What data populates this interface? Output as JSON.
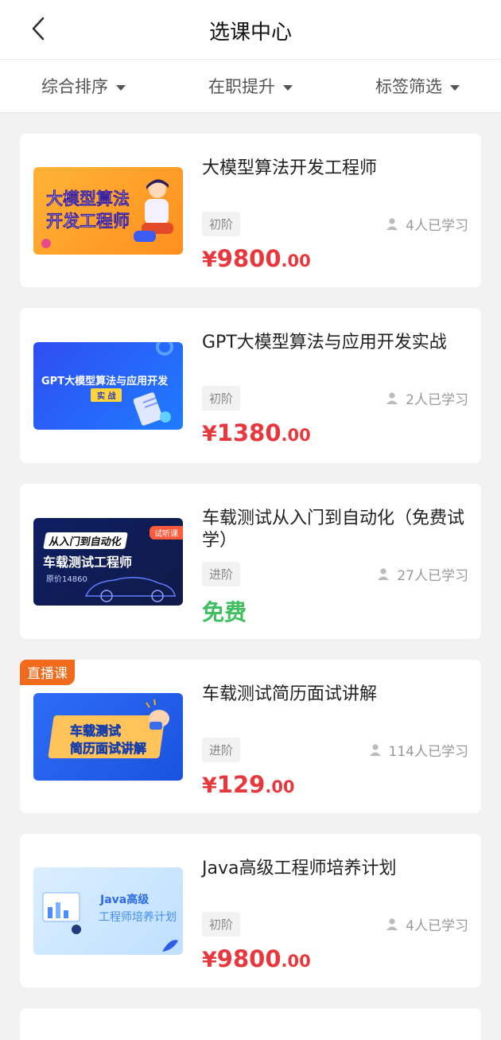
{
  "header": {
    "title": "选课中心",
    "back_icon": "chevron-left-icon"
  },
  "filters": [
    {
      "label": "综合排序"
    },
    {
      "label": "在职提升"
    },
    {
      "label": "标签筛选"
    }
  ],
  "courses": [
    {
      "title": "大模型算法开发工程师",
      "level": "初阶",
      "learners": "4人已学习",
      "price": {
        "yen": "¥",
        "int": "9800",
        "dec": ".00"
      },
      "thumb": {
        "line1": "大模型算法",
        "line2": "开发工程师"
      }
    },
    {
      "title": "GPT大模型算法与应用开发实战",
      "level": "初阶",
      "learners": "2人已学习",
      "price": {
        "yen": "¥",
        "int": "1380",
        "dec": ".00"
      },
      "thumb": {
        "line1": "GPT大模型算法与应用开发",
        "tag": "实 战"
      }
    },
    {
      "title": "车载测试从入门到自动化（免费试学）",
      "level": "进阶",
      "learners": "27人已学习",
      "price_text": "免费",
      "thumb": {
        "line1": "从入门到自动化",
        "line2": "车载测试工程师",
        "line3": "原价14860",
        "tag": "试听课"
      }
    },
    {
      "badge": "直播课",
      "title": "车载测试简历面试讲解",
      "level": "进阶",
      "learners": "114人已学习",
      "price": {
        "yen": "¥",
        "int": "129",
        "dec": ".00"
      },
      "thumb": {
        "line1": "车载测试",
        "line2": "简历面试讲解"
      }
    },
    {
      "title": "Java高级工程师培养计划",
      "level": "初阶",
      "learners": "4人已学习",
      "price": {
        "yen": "¥",
        "int": "9800",
        "dec": ".00"
      },
      "thumb": {
        "line1": "Java高级",
        "line2": "工程师培养计划"
      }
    }
  ]
}
